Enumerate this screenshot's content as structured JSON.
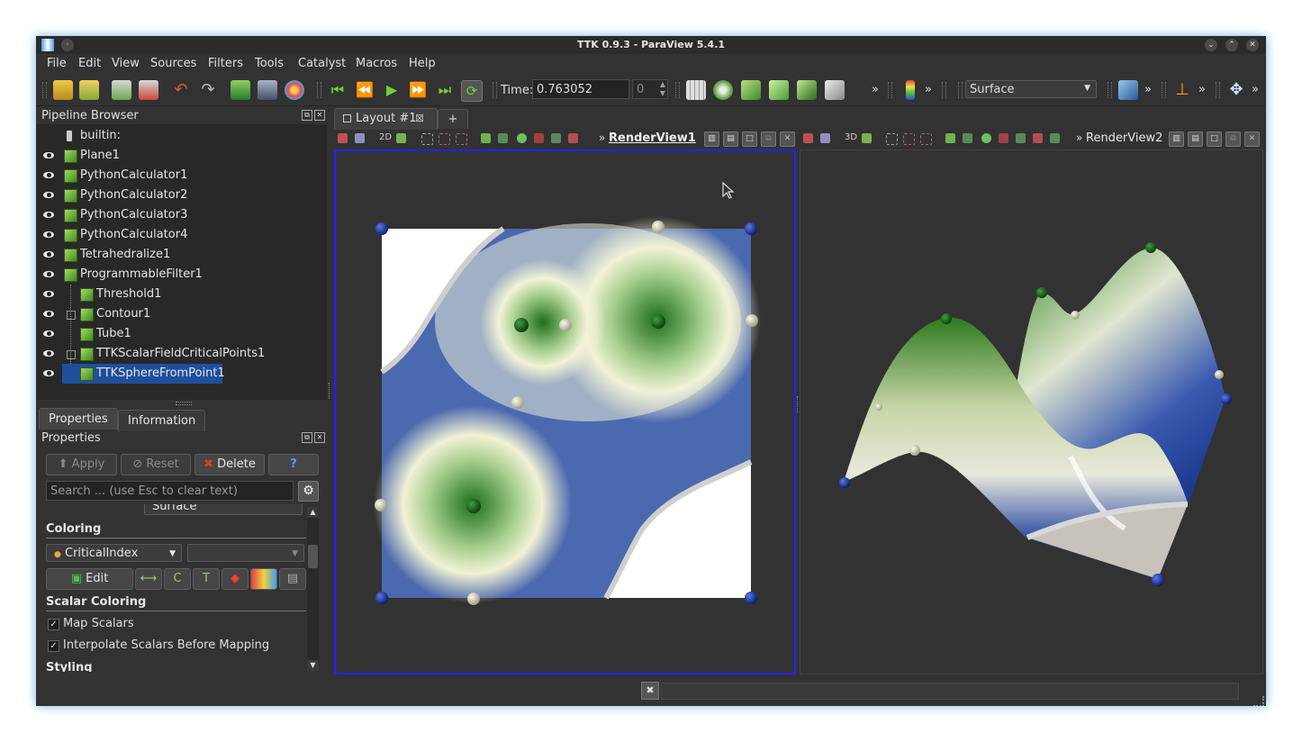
{
  "window": {
    "title": "TTK 0.9.3 - ParaView 5.4.1"
  },
  "menu": [
    "File",
    "Edit",
    "View",
    "Sources",
    "Filters",
    "Tools",
    "Catalyst",
    "Macros",
    "Help"
  ],
  "toolbar": {
    "time_label": "Time:",
    "time_value": "0.763052",
    "time_step": "0",
    "representation": "Surface",
    "overflow": "»"
  },
  "pipeline": {
    "title": "Pipeline Browser",
    "items": [
      {
        "label": "builtin:"
      },
      {
        "label": "Plane1"
      },
      {
        "label": "PythonCalculator1"
      },
      {
        "label": "PythonCalculator2"
      },
      {
        "label": "PythonCalculator3"
      },
      {
        "label": "PythonCalculator4"
      },
      {
        "label": "Tetrahedralize1"
      },
      {
        "label": "ProgrammableFilter1"
      },
      {
        "label": "Threshold1"
      },
      {
        "label": "Contour1"
      },
      {
        "label": "Tube1"
      },
      {
        "label": "TTKScalarFieldCriticalPoints1"
      },
      {
        "label": "TTKSphereFromPoint1"
      }
    ]
  },
  "tabs": {
    "properties": "Properties",
    "information": "Information"
  },
  "properties": {
    "title": "Properties",
    "apply": "Apply",
    "reset": "Reset",
    "delete": "Delete",
    "help": "?",
    "search_placeholder": "Search ... (use Esc to clear text)",
    "clipped_combo": "Surface",
    "coloring_header": "Coloring",
    "color_by": "CriticalIndex",
    "edit": "Edit",
    "scalar_coloring_header": "Scalar Coloring",
    "map_scalars": "Map Scalars",
    "interpolate": "Interpolate Scalars Before Mapping",
    "styling_header": "Styling",
    "check_mark": "✓"
  },
  "layout": {
    "tab_label": "Layout #1",
    "add_tab": "+",
    "view1": "RenderView1",
    "view2": "RenderView2",
    "mode2d": "2D",
    "mode3d": "3D",
    "chevron": "»"
  },
  "colors": {
    "accent_blue": "#1f4f9c",
    "active_view_border": "#2222ff",
    "field_green": "#1e6e1e",
    "field_blue": "#1f3c96"
  }
}
